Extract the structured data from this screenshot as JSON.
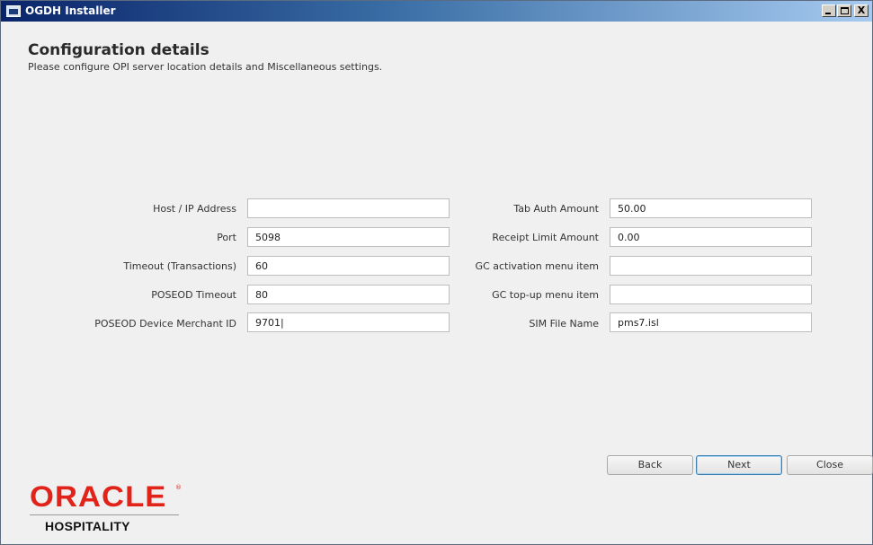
{
  "window": {
    "title": "OGDH Installer",
    "controls": {
      "minimize": "_",
      "maximize": "□",
      "close": "X"
    }
  },
  "header": {
    "title": "Configuration details",
    "subtitle": "Please configure OPI server location details and Miscellaneous settings."
  },
  "form": {
    "left": [
      {
        "label": "Host / IP Address",
        "value": ""
      },
      {
        "label": "Port",
        "value": "5098"
      },
      {
        "label": "Timeout (Transactions)",
        "value": "60"
      },
      {
        "label": "POSEOD Timeout",
        "value": "80"
      },
      {
        "label": "POSEOD Device Merchant ID",
        "value": "9701|"
      }
    ],
    "right": [
      {
        "label": "Tab Auth Amount",
        "value": "50.00"
      },
      {
        "label": "Receipt Limit Amount",
        "value": "0.00"
      },
      {
        "label": "GC activation menu item",
        "value": ""
      },
      {
        "label": "GC top-up menu item",
        "value": ""
      },
      {
        "label": "SIM File Name",
        "value": "pms7.isl"
      }
    ]
  },
  "buttons": {
    "back": "Back",
    "next": "Next",
    "close": "Close"
  },
  "logo": {
    "brand": "ORACLE",
    "reg": "®",
    "product": "HOSPITALITY"
  },
  "colors": {
    "titlebar_start": "#0a246a",
    "brand_red": "#e2231a",
    "focus_blue": "#3c7fb1"
  }
}
